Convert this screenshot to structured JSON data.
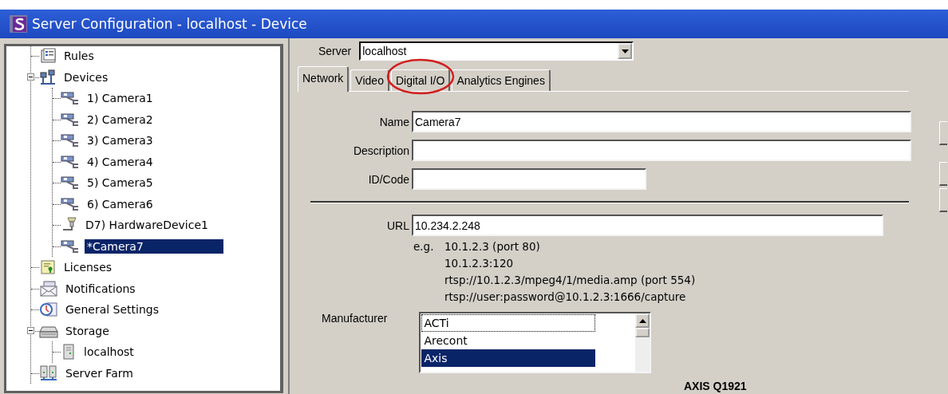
{
  "window": {
    "title": "Server Configuration - localhost - Device"
  },
  "tree": [
    {
      "label": "Rules",
      "kind": "rules",
      "selected": false
    },
    {
      "label": "Devices",
      "kind": "devices",
      "selected": false,
      "expanded": true,
      "children": [
        {
          "label": "1) Camera1",
          "kind": "camera",
          "selected": false
        },
        {
          "label": "2) Camera2",
          "kind": "camera",
          "selected": false
        },
        {
          "label": "3) Camera3",
          "kind": "camera",
          "selected": false
        },
        {
          "label": "4) Camera4",
          "kind": "camera",
          "selected": false
        },
        {
          "label": "5) Camera5",
          "kind": "camera",
          "selected": false
        },
        {
          "label": "6) Camera6",
          "kind": "camera",
          "selected": false
        },
        {
          "label": "D7) HardwareDevice1",
          "kind": "hardware",
          "selected": false
        },
        {
          "label": "*Camera7",
          "kind": "camera",
          "selected": true
        }
      ]
    },
    {
      "label": "Licenses",
      "kind": "licenses",
      "selected": false
    },
    {
      "label": "Notifications",
      "kind": "notifications",
      "selected": false
    },
    {
      "label": "General Settings",
      "kind": "settings",
      "selected": false
    },
    {
      "label": "Storage",
      "kind": "storage",
      "selected": false,
      "expanded": true,
      "children": [
        {
          "label": "localhost",
          "kind": "server",
          "selected": false
        }
      ]
    },
    {
      "label": "Server Farm",
      "kind": "farm",
      "selected": false
    }
  ],
  "server": {
    "label": "Server",
    "value": "localhost"
  },
  "tabs": [
    {
      "label": "Network",
      "selected": true,
      "circled": false
    },
    {
      "label": "Video",
      "selected": false,
      "circled": false
    },
    {
      "label": "Digital I/O",
      "selected": false,
      "circled": true
    },
    {
      "label": "Analytics Engines",
      "selected": false,
      "circled": false
    }
  ],
  "fields": [
    {
      "label": "Name",
      "value": "Camera7",
      "kind": "wide"
    },
    {
      "label": "Description",
      "kind": "wide"
    },
    {
      "label": "ID/Code",
      "kind": "short"
    }
  ],
  "url": {
    "label": "URL",
    "value": "10.234.2.248",
    "hint_prefix": "e.g.",
    "hints": [
      "10.1.2.3 (port 80)",
      "10.1.2.3:120",
      "rtsp://10.1.2.3/mpeg4/1/media.amp (port 554)",
      "rtsp://user:password@10.1.2.3:1666/capture"
    ]
  },
  "manufacturer": {
    "label": "Manufacturer",
    "items": [
      {
        "label": "ACTi",
        "selected": false,
        "focused": true
      },
      {
        "label": "Arecont",
        "selected": false,
        "focused": false
      },
      {
        "label": "Axis",
        "selected": true,
        "focused": false
      }
    ]
  },
  "model": "AXIS Q1921"
}
